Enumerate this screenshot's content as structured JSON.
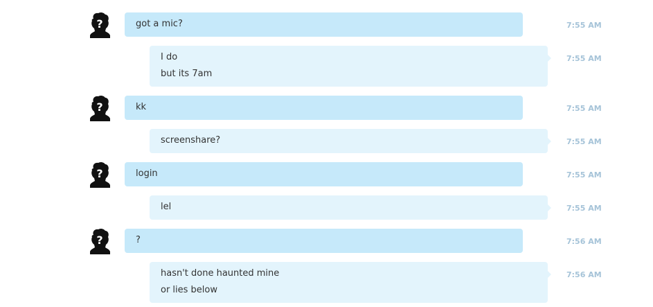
{
  "colors": {
    "incoming_bubble": "#c6e9fa",
    "outgoing_bubble": "#e3f4fc",
    "timestamp": "#a5c3d8",
    "text": "#333333"
  },
  "messages": [
    {
      "direction": "incoming",
      "avatar": "unknown-user-icon",
      "lines": [
        "got a mic?"
      ],
      "time": "7:55 AM"
    },
    {
      "direction": "outgoing",
      "lines": [
        "I do",
        "but its 7am"
      ],
      "time": "7:55 AM"
    },
    {
      "direction": "incoming",
      "avatar": "unknown-user-icon",
      "lines": [
        "kk"
      ],
      "time": "7:55 AM"
    },
    {
      "direction": "outgoing",
      "lines": [
        "screenshare?"
      ],
      "time": "7:55 AM"
    },
    {
      "direction": "incoming",
      "avatar": "unknown-user-icon",
      "lines": [
        "login"
      ],
      "time": "7:55 AM"
    },
    {
      "direction": "outgoing",
      "lines": [
        "lel"
      ],
      "time": "7:55 AM"
    },
    {
      "direction": "incoming",
      "avatar": "unknown-user-icon",
      "lines": [
        "?"
      ],
      "time": "7:56 AM"
    },
    {
      "direction": "outgoing",
      "lines": [
        "hasn't done haunted mine",
        "or lies below"
      ],
      "time": "7:56 AM"
    }
  ]
}
